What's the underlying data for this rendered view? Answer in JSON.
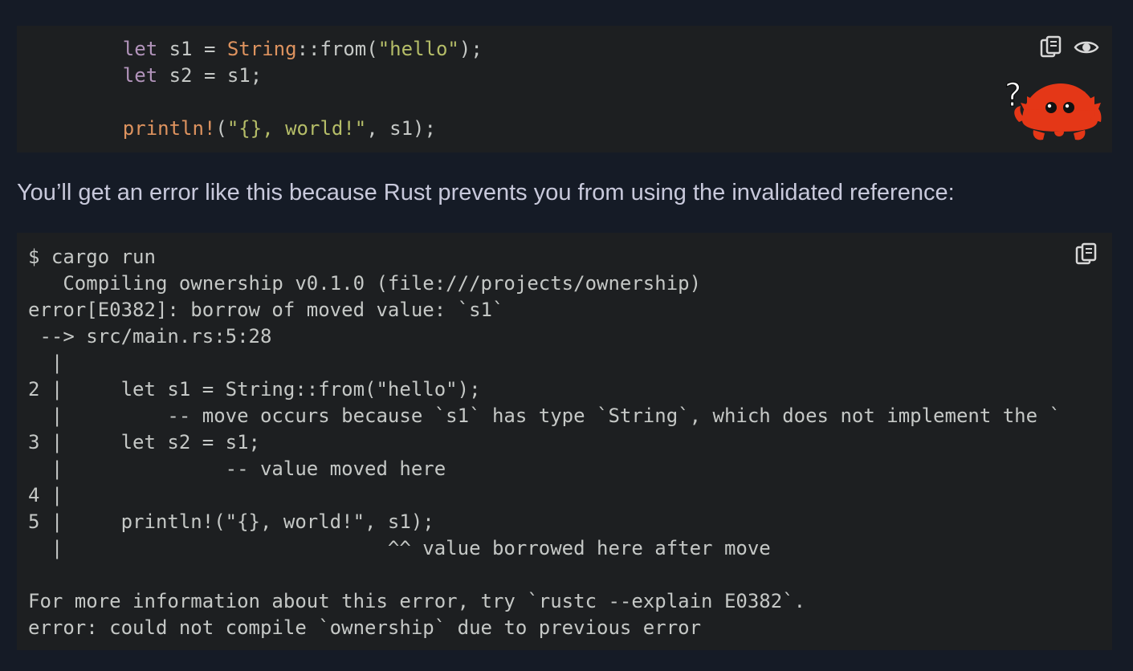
{
  "first_code": {
    "lines": [
      [
        {
          "c": "",
          "t": "    "
        },
        {
          "c": "kw",
          "t": "let"
        },
        {
          "c": "",
          "t": " s1 = "
        },
        {
          "c": "ty",
          "t": "String"
        },
        {
          "c": "",
          "t": "::from("
        },
        {
          "c": "str",
          "t": "\"hello\""
        },
        {
          "c": "",
          "t": ");"
        }
      ],
      [
        {
          "c": "",
          "t": "    "
        },
        {
          "c": "kw",
          "t": "let"
        },
        {
          "c": "",
          "t": " s2 = s1;"
        }
      ],
      [
        {
          "c": "",
          "t": ""
        }
      ],
      [
        {
          "c": "",
          "t": "    "
        },
        {
          "c": "mac",
          "t": "println!"
        },
        {
          "c": "",
          "t": "("
        },
        {
          "c": "str",
          "t": "\"{}, world!\""
        },
        {
          "c": "",
          "t": ", s1);"
        }
      ]
    ],
    "copy_icon": "copy-icon",
    "toggle_icon": "eye-icon",
    "ferris_icon": "ferris-does-not-compile-icon"
  },
  "prose": {
    "text": "You’ll get an error like this because Rust prevents you from using the invalidated reference:"
  },
  "output": {
    "lines": [
      "$ cargo run",
      "   Compiling ownership v0.1.0 (file:///projects/ownership)",
      "error[E0382]: borrow of moved value: `s1`",
      " --> src/main.rs:5:28",
      "  |",
      "2 |     let s1 = String::from(\"hello\");",
      "  |         -- move occurs because `s1` has type `String`, which does not implement the `",
      "3 |     let s2 = s1;",
      "  |              -- value moved here",
      "4 |",
      "5 |     println!(\"{}, world!\", s1);",
      "  |                            ^^ value borrowed here after move",
      "",
      "For more information about this error, try `rustc --explain E0382`.",
      "error: could not compile `ownership` due to previous error"
    ],
    "copy_icon": "copy-icon"
  },
  "colors": {
    "page_background": "#151b26",
    "code_background": "#1d1f21",
    "code_text": "#c5c8c6",
    "keyword": "#b294bb",
    "type_and_macro": "#de935f",
    "string": "#b5bd68",
    "prose_text": "#c8c9db",
    "ferris_red": "#e43717"
  }
}
